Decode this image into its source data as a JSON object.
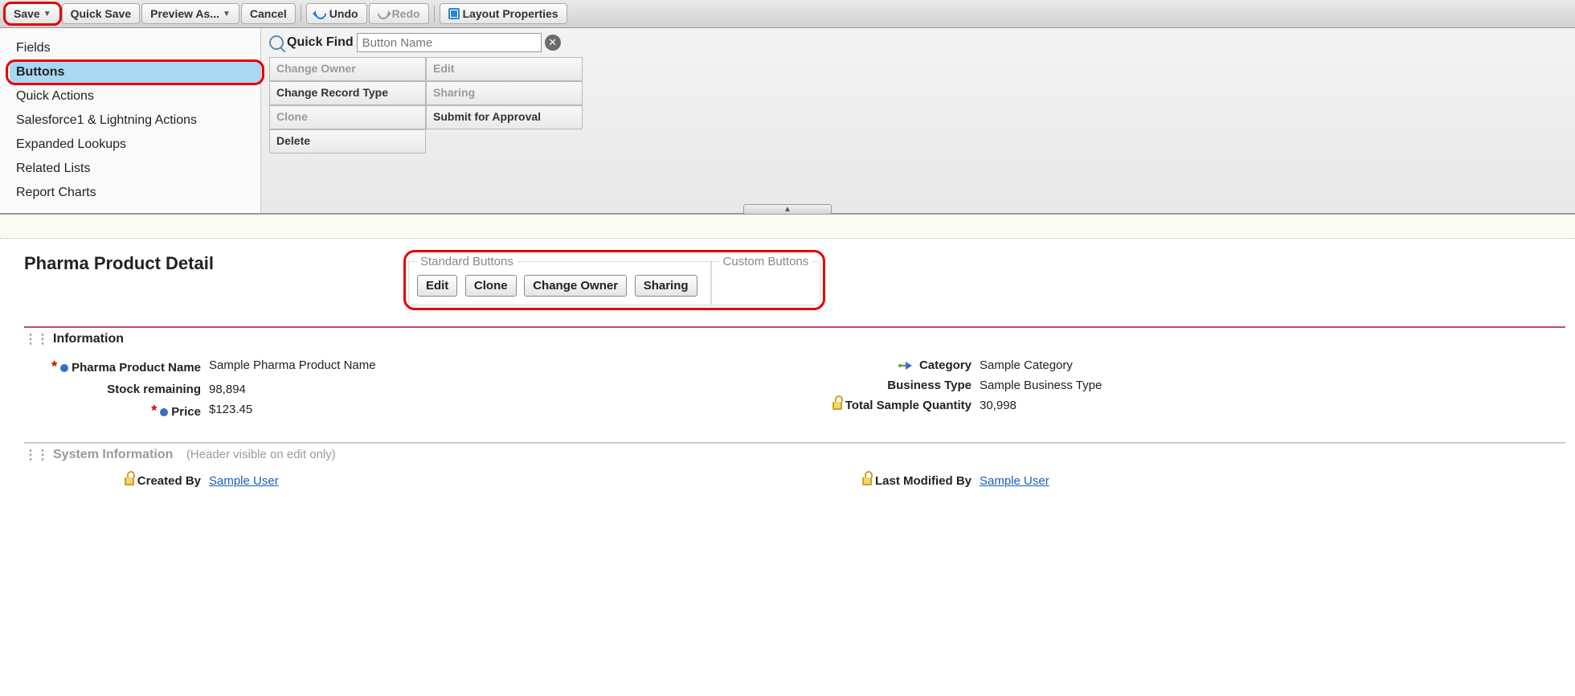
{
  "toolbar": {
    "save": "Save",
    "quick_save": "Quick Save",
    "preview_as": "Preview As...",
    "cancel": "Cancel",
    "undo": "Undo",
    "redo": "Redo",
    "layout_properties": "Layout Properties"
  },
  "sidebar": {
    "items": [
      "Fields",
      "Buttons",
      "Quick Actions",
      "Salesforce1 & Lightning Actions",
      "Expanded Lookups",
      "Related Lists",
      "Report Charts"
    ],
    "active_index": 1
  },
  "quick_find": {
    "label": "Quick Find",
    "placeholder": "Button Name"
  },
  "palette": {
    "col1": [
      "Change Owner",
      "Change Record Type",
      "Clone",
      "Delete"
    ],
    "col2": [
      "Edit",
      "Sharing",
      "Submit for Approval"
    ],
    "used": [
      "Change Owner",
      "Clone",
      "Edit",
      "Sharing"
    ]
  },
  "detail": {
    "title": "Pharma Product Detail",
    "standard_buttons_legend": "Standard Buttons",
    "custom_buttons_legend": "Custom Buttons",
    "standard_buttons": [
      "Edit",
      "Clone",
      "Change Owner",
      "Sharing"
    ]
  },
  "section_info": {
    "title": "Information",
    "left": [
      {
        "label": "Pharma Product Name",
        "value": "Sample Pharma Product Name",
        "required": true,
        "dot": true
      },
      {
        "label": "Stock remaining",
        "value": "98,894"
      },
      {
        "label": "Price",
        "value": "$123.45",
        "required": true,
        "dot": true
      }
    ],
    "right": [
      {
        "label": "Category",
        "value": "Sample Category",
        "depend": true
      },
      {
        "label": "Business Type",
        "value": "Sample Business Type"
      },
      {
        "label": "Total Sample Quantity",
        "value": "30,998",
        "locked": true
      }
    ]
  },
  "section_system": {
    "title": "System Information",
    "note": "(Header visible on edit only)",
    "left": [
      {
        "label": "Created By",
        "value": "Sample User",
        "locked": true,
        "link": true
      }
    ],
    "right": [
      {
        "label": "Last Modified By",
        "value": "Sample User",
        "locked": true,
        "link": true
      }
    ]
  }
}
